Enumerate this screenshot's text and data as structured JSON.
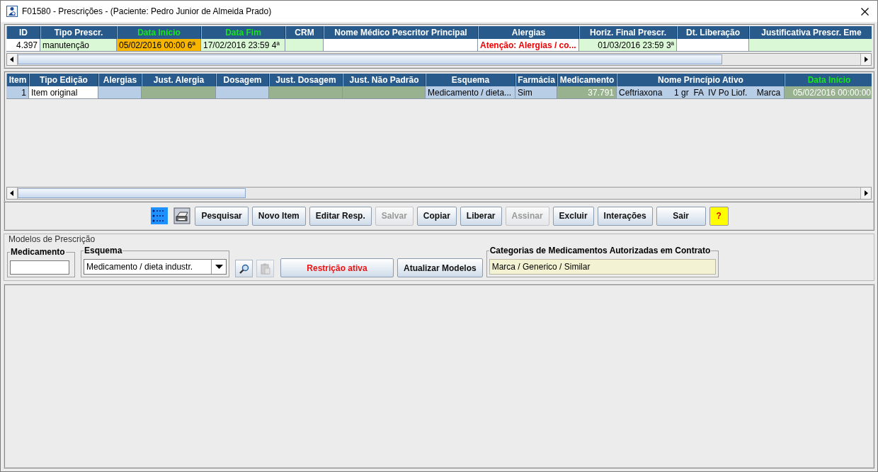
{
  "window": {
    "title": "F01580 - Prescrições - (Paciente: Pedro Junior de Almeida Prado)"
  },
  "prescriptions": {
    "columns": [
      {
        "label": "ID",
        "accent": false
      },
      {
        "label": "Tipo Prescr.",
        "accent": false
      },
      {
        "label": "Data Início",
        "accent": true
      },
      {
        "label": "Data Fim",
        "accent": true
      },
      {
        "label": "CRM",
        "accent": false
      },
      {
        "label": "Nome Médico Pescritor Principal",
        "accent": false
      },
      {
        "label": "Alergias",
        "accent": false
      },
      {
        "label": "Horiz. Final Prescr.",
        "accent": false
      },
      {
        "label": "Dt. Liberação",
        "accent": false
      },
      {
        "label": "Justificativa Prescr. Eme",
        "accent": false
      }
    ],
    "rows": [
      [
        {
          "text": "4.397",
          "color": "#ffffff",
          "alert": false
        },
        {
          "text": "manutenção",
          "color": "#dbf8d6",
          "alert": false
        },
        {
          "text": "05/02/2016 00:00 6ª",
          "color": "#f7b500",
          "alert": false
        },
        {
          "text": "17/02/2016 23:59 4ª",
          "color": "#dbf8d6",
          "alert": false
        },
        {
          "color": "#dbf8d6"
        },
        {
          "color": "#ffffff"
        },
        {
          "text": "Atenção: Alergias / co...",
          "color": "#ffffff",
          "alert": true
        },
        {
          "text": "01/03/2016 23:59 3ª",
          "color": "#dbf8d6",
          "alert": false
        },
        {
          "color": "#ffffff"
        },
        {
          "color": "#dbf8d6"
        }
      ]
    ]
  },
  "items": {
    "columns": [
      {
        "label": "Item",
        "accent": false
      },
      {
        "label": "Tipo Edição",
        "accent": false
      },
      {
        "label": "Alergias",
        "accent": false
      },
      {
        "label": "Just. Alergia",
        "accent": false
      },
      {
        "label": "Dosagem",
        "accent": false
      },
      {
        "label": "Just. Dosagem",
        "accent": false
      },
      {
        "label": "Just. Não Padrão",
        "accent": false
      },
      {
        "label": "Esquema",
        "accent": false
      },
      {
        "label": "Farmácia",
        "accent": false
      },
      {
        "label": "Medicamento",
        "accent": false
      },
      {
        "label": "Nome Princípio Ativo",
        "accent": false
      },
      {
        "label": "Data Início",
        "accent": true
      }
    ],
    "rows": [
      [
        {
          "text": "1",
          "color": "#b8cee6"
        },
        {
          "text": "Item original",
          "color": "#ffffff"
        },
        {
          "color": "#b8cee6"
        },
        {
          "color": "#98b290"
        },
        {
          "color": "#b8cee6"
        },
        {
          "color": "#98b290"
        },
        {
          "color": "#98b290"
        },
        {
          "text": "Medicamento / dieta...",
          "color": "#b8cee6"
        },
        {
          "text": "Sim",
          "color": "#b8cee6"
        },
        {
          "text": "37.791",
          "color": "#98b290"
        },
        {
          "text": "Ceftriaxona     1 gr  FA  IV Po Liof.    Marca",
          "color": "#b8cee6"
        },
        {
          "text": "05/02/2016 00:00:00",
          "color": "#98b290"
        }
      ]
    ]
  },
  "toolbar": [
    {
      "kind": "list-icon",
      "disabled": false
    },
    {
      "kind": "printer-icon",
      "disabled": false
    },
    {
      "kind": "text",
      "label": "Pesquisar",
      "disabled": false
    },
    {
      "kind": "text",
      "label": "Novo Item",
      "disabled": false
    },
    {
      "kind": "text",
      "label": "Editar Resp.",
      "disabled": false
    },
    {
      "kind": "text",
      "label": "Salvar",
      "disabled": true
    },
    {
      "kind": "text",
      "label": "Copiar",
      "disabled": false
    },
    {
      "kind": "text",
      "label": "Liberar",
      "disabled": false
    },
    {
      "kind": "text",
      "label": "Assinar",
      "disabled": true
    },
    {
      "kind": "text",
      "label": "Excluir",
      "disabled": false
    },
    {
      "kind": "text",
      "label": "Interações",
      "disabled": false
    },
    {
      "kind": "wide",
      "label": "Sair",
      "disabled": false
    },
    {
      "kind": "help",
      "label": "?",
      "disabled": false
    }
  ],
  "models": {
    "title": "Modelos de Prescrição",
    "medicamento": {
      "legend": "Medicamento"
    },
    "esquema": {
      "legend": "Esquema",
      "value": "Medicamento / dieta industr."
    },
    "search_disabled": false,
    "clipboard_disabled": true,
    "restriction_button": "Restrição ativa",
    "update_button": "Atualizar Modelos",
    "categories": {
      "legend": "Categorias de Medicamentos Autorizadas em Contrato",
      "value": "Marca / Generico / Similar"
    }
  }
}
